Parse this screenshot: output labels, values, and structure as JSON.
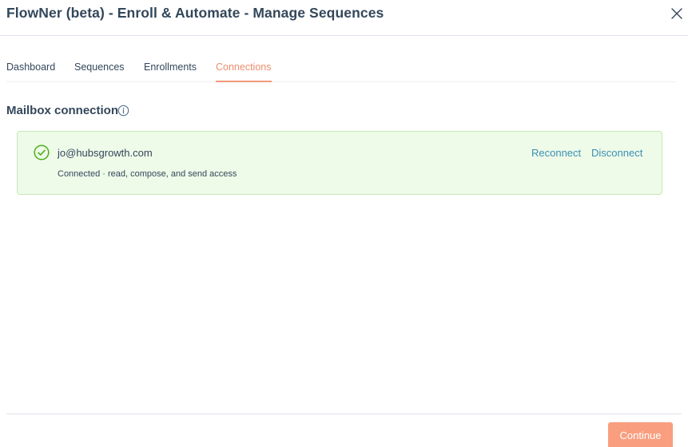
{
  "window": {
    "title": "FlowNer (beta) - Enroll & Automate - Manage Sequences",
    "close_icon": "close-icon"
  },
  "tabs": [
    {
      "label": "Dashboard",
      "active": false
    },
    {
      "label": "Sequences",
      "active": false
    },
    {
      "label": "Enrollments",
      "active": false
    },
    {
      "label": "Connections",
      "active": true
    }
  ],
  "section": {
    "title": "Mailbox connection",
    "info_icon": "info-icon"
  },
  "connection": {
    "status_icon": "check-circle-icon",
    "email": "jo@hubsgrowth.com",
    "status_text": "Connected · read, compose, and send access",
    "reconnect_label": "Reconnect",
    "disconnect_label": "Disconnect"
  },
  "footer": {
    "continue_label": "Continue"
  },
  "colors": {
    "accent": "#f2997a",
    "link": "#3b8fb5",
    "success_bg": "#eefbe8",
    "success_border": "#c7e8b6",
    "success_icon": "#4caf1a",
    "text": "#33475b"
  }
}
